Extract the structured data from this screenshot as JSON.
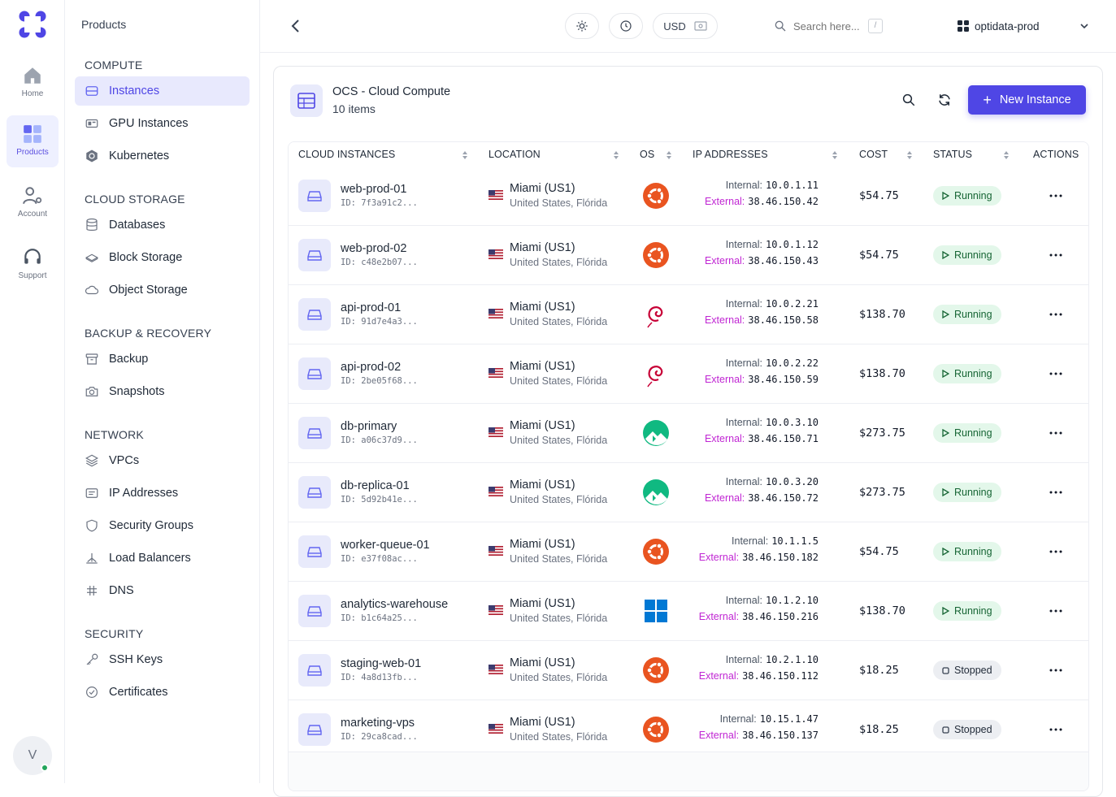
{
  "rail": {
    "items": [
      {
        "label": "Home",
        "icon": "home-icon"
      },
      {
        "label": "Products",
        "icon": "grid-icon"
      },
      {
        "label": "Account",
        "icon": "user-gear-icon"
      },
      {
        "label": "Support",
        "icon": "headset-icon"
      }
    ],
    "avatar": "V"
  },
  "sidebar": {
    "title": "Products",
    "sections": [
      {
        "title": "COMPUTE",
        "items": [
          {
            "label": "Instances",
            "icon": "server-icon"
          },
          {
            "label": "GPU Instances",
            "icon": "gpu-icon"
          },
          {
            "label": "Kubernetes",
            "icon": "kubernetes-icon"
          }
        ]
      },
      {
        "title": "CLOUD STORAGE",
        "items": [
          {
            "label": "Databases",
            "icon": "database-icon"
          },
          {
            "label": "Block Storage",
            "icon": "block-storage-icon"
          },
          {
            "label": "Object Storage",
            "icon": "cloud-icon"
          }
        ]
      },
      {
        "title": "BACKUP & RECOVERY",
        "items": [
          {
            "label": "Backup",
            "icon": "archive-icon"
          },
          {
            "label": "Snapshots",
            "icon": "camera-icon"
          }
        ]
      },
      {
        "title": "NETWORK",
        "items": [
          {
            "label": "VPCs",
            "icon": "layers-icon"
          },
          {
            "label": "IP Addresses",
            "icon": "ip-icon"
          },
          {
            "label": "Security Groups",
            "icon": "shield-icon"
          },
          {
            "label": "Load Balancers",
            "icon": "load-balancer-icon"
          },
          {
            "label": "DNS",
            "icon": "dns-icon"
          }
        ]
      },
      {
        "title": "SECURITY",
        "items": [
          {
            "label": "SSH Keys",
            "icon": "key-icon"
          },
          {
            "label": "Certificates",
            "icon": "certificate-icon"
          }
        ]
      }
    ]
  },
  "header": {
    "currency": "USD",
    "search_placeholder": "Search here...",
    "search_shortcut": "/",
    "project": "optidata-prod"
  },
  "card": {
    "title": "OCS - Cloud Compute",
    "count": "10 items",
    "new_button": "New Instance"
  },
  "table": {
    "columns": [
      "CLOUD INSTANCES",
      "LOCATION",
      "OS",
      "IP ADDRESSES",
      "COST",
      "STATUS",
      "ACTIONS"
    ],
    "internal_label": "Internal:",
    "external_label": "External:",
    "rows": [
      {
        "name": "web-prod-01",
        "id": "ID: 7f3a91c2...",
        "city": "Miami (US1)",
        "region": "United States, Flórida",
        "os": "ubuntu",
        "internal": "10.0.1.11",
        "external": "38.46.150.42",
        "cost": "$54.75",
        "status": "Running"
      },
      {
        "name": "web-prod-02",
        "id": "ID: c48e2b07...",
        "city": "Miami (US1)",
        "region": "United States, Flórida",
        "os": "ubuntu",
        "internal": "10.0.1.12",
        "external": "38.46.150.43",
        "cost": "$54.75",
        "status": "Running"
      },
      {
        "name": "api-prod-01",
        "id": "ID: 91d7e4a3...",
        "city": "Miami (US1)",
        "region": "United States, Flórida",
        "os": "debian",
        "internal": "10.0.2.21",
        "external": "38.46.150.58",
        "cost": "$138.70",
        "status": "Running"
      },
      {
        "name": "api-prod-02",
        "id": "ID: 2be05f68...",
        "city": "Miami (US1)",
        "region": "United States, Flórida",
        "os": "debian",
        "internal": "10.0.2.22",
        "external": "38.46.150.59",
        "cost": "$138.70",
        "status": "Running"
      },
      {
        "name": "db-primary",
        "id": "ID: a06c37d9...",
        "city": "Miami (US1)",
        "region": "United States, Flórida",
        "os": "rocky",
        "internal": "10.0.3.10",
        "external": "38.46.150.71",
        "cost": "$273.75",
        "status": "Running"
      },
      {
        "name": "db-replica-01",
        "id": "ID: 5d92b41e...",
        "city": "Miami (US1)",
        "region": "United States, Flórida",
        "os": "rocky",
        "internal": "10.0.3.20",
        "external": "38.46.150.72",
        "cost": "$273.75",
        "status": "Running"
      },
      {
        "name": "worker-queue-01",
        "id": "ID: e37f08ac...",
        "city": "Miami (US1)",
        "region": "United States, Flórida",
        "os": "ubuntu",
        "internal": "10.1.1.5",
        "external": "38.46.150.182",
        "cost": "$54.75",
        "status": "Running"
      },
      {
        "name": "analytics-warehouse",
        "id": "ID: b1c64a25...",
        "city": "Miami (US1)",
        "region": "United States, Flórida",
        "os": "windows",
        "internal": "10.1.2.10",
        "external": "38.46.150.216",
        "cost": "$138.70",
        "status": "Running"
      },
      {
        "name": "staging-web-01",
        "id": "ID: 4a8d13fb...",
        "city": "Miami (US1)",
        "region": "United States, Flórida",
        "os": "ubuntu",
        "internal": "10.2.1.10",
        "external": "38.46.150.112",
        "cost": "$18.25",
        "status": "Stopped"
      },
      {
        "name": "marketing-vps",
        "id": "ID: 29ca8cad...",
        "city": "Miami (US1)",
        "region": "United States, Flórida",
        "os": "ubuntu",
        "internal": "10.15.1.47",
        "external": "38.46.150.137",
        "cost": "$18.25",
        "status": "Stopped"
      }
    ]
  },
  "colors": {
    "accent": "#4f46e5",
    "running": "#166534",
    "ubuntu": "#e95420",
    "debian": "#c70036",
    "rocky": "#10b981",
    "windows": "#0078d4"
  }
}
